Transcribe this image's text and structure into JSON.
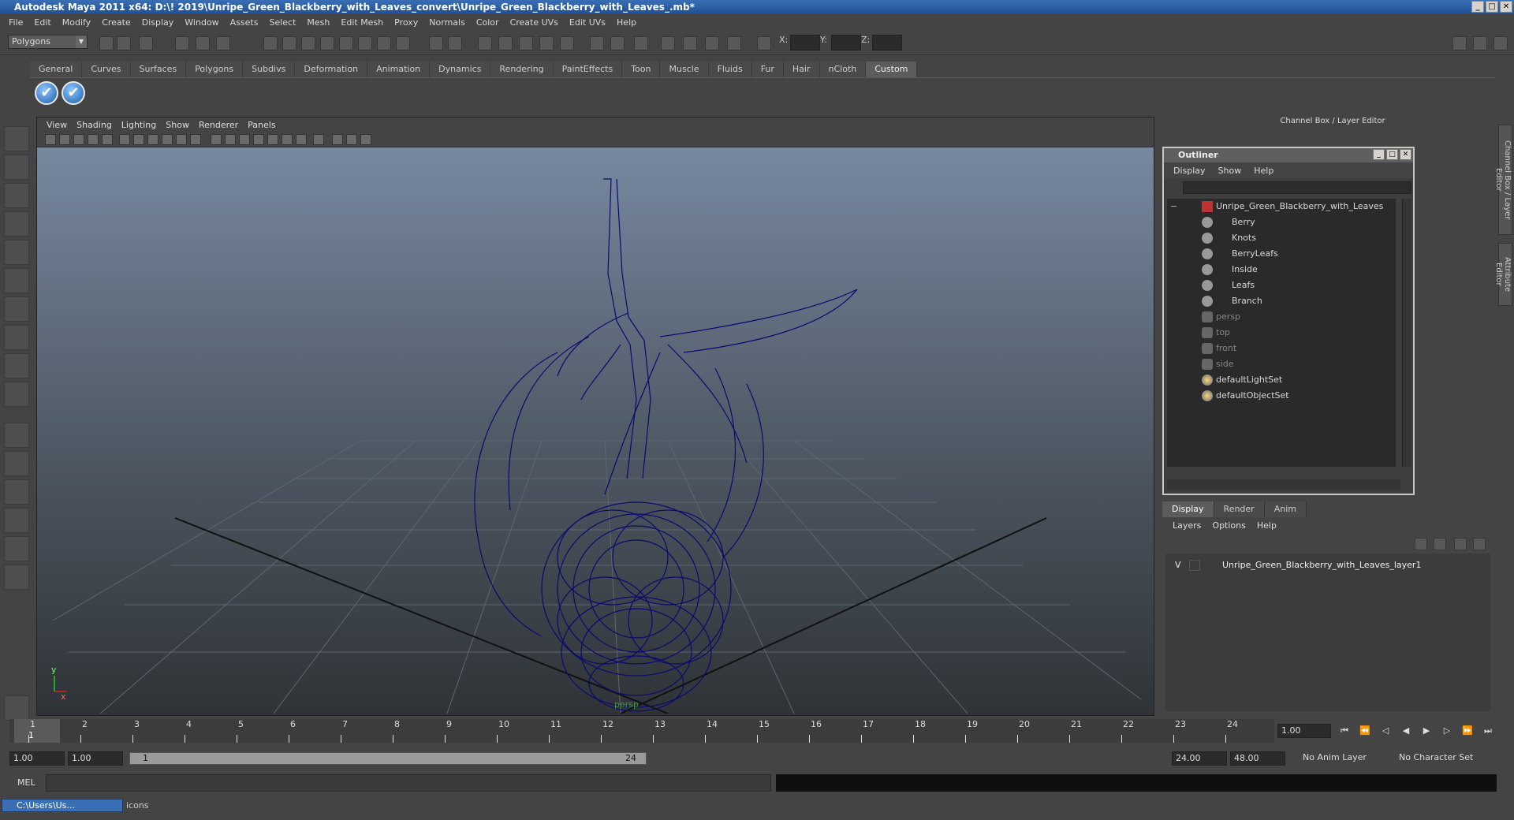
{
  "window": {
    "title": "Autodesk Maya 2011 x64: D:\\! 2019\\Unripe_Green_Blackberry_with_Leaves_convert\\Unripe_Green_Blackberry_with_Leaves_.mb*",
    "min": "_",
    "max": "□",
    "close": "✕"
  },
  "menubar": [
    "File",
    "Edit",
    "Modify",
    "Create",
    "Display",
    "Window",
    "Assets",
    "Select",
    "Mesh",
    "Edit Mesh",
    "Proxy",
    "Normals",
    "Color",
    "Create UVs",
    "Edit UVs",
    "Help"
  ],
  "status": {
    "mode": "Polygons",
    "x_label": "X:",
    "y_label": "Y:",
    "z_label": "Z:"
  },
  "shelf_tabs": [
    "General",
    "Curves",
    "Surfaces",
    "Polygons",
    "Subdivs",
    "Deformation",
    "Animation",
    "Dynamics",
    "Rendering",
    "PaintEffects",
    "Toon",
    "Muscle",
    "Fluids",
    "Fur",
    "Hair",
    "nCloth",
    "Custom"
  ],
  "shelf_active": "Custom",
  "shelf_buttons": [
    "✔",
    "✔"
  ],
  "viewport": {
    "menu": [
      "View",
      "Shading",
      "Lighting",
      "Show",
      "Renderer",
      "Panels"
    ],
    "camera": "persp",
    "axis_x": "x",
    "axis_y": "y"
  },
  "channel_box_title": "Channel Box / Layer Editor",
  "side_tabs": [
    "Channel Box / Layer Editor",
    "Attribute Editor"
  ],
  "outliner": {
    "title": "Outliner",
    "menu": [
      "Display",
      "Show",
      "Help"
    ],
    "collapse": "−",
    "root": "Unripe_Green_Blackberry_with_Leaves",
    "children": [
      "Berry",
      "Knots",
      "BerryLeafs",
      "Inside",
      "Leafs",
      "Branch"
    ],
    "cameras": [
      "persp",
      "top",
      "front",
      "side"
    ],
    "sets": [
      "defaultLightSet",
      "defaultObjectSet"
    ]
  },
  "layer_editor": {
    "tabs": [
      "Display",
      "Render",
      "Anim"
    ],
    "active_tab": "Display",
    "menu": [
      "Layers",
      "Options",
      "Help"
    ],
    "layer_visible": "V",
    "layer_name": "Unripe_Green_Blackberry_with_Leaves_layer1"
  },
  "timeline": {
    "ticks": [
      "1",
      "2",
      "3",
      "4",
      "5",
      "6",
      "7",
      "8",
      "9",
      "10",
      "11",
      "12",
      "13",
      "14",
      "15",
      "16",
      "17",
      "18",
      "19",
      "20",
      "21",
      "22",
      "23",
      "24"
    ],
    "current_frame": "1",
    "playback_field": "1.00"
  },
  "range": {
    "start": "1.00",
    "current": "1.00",
    "slider_start": "1",
    "slider_end": "24",
    "end": "24.00",
    "max": "48.00",
    "anim_layer": "No Anim Layer",
    "character_set": "No Character Set"
  },
  "command": {
    "label": "MEL"
  },
  "help": {
    "task": "C:\\Users\\Us...",
    "text": "icons"
  },
  "colors": {
    "wire": "#0a0a6e",
    "title_blue": "#2b5ca3",
    "grid": "#5a6068"
  }
}
